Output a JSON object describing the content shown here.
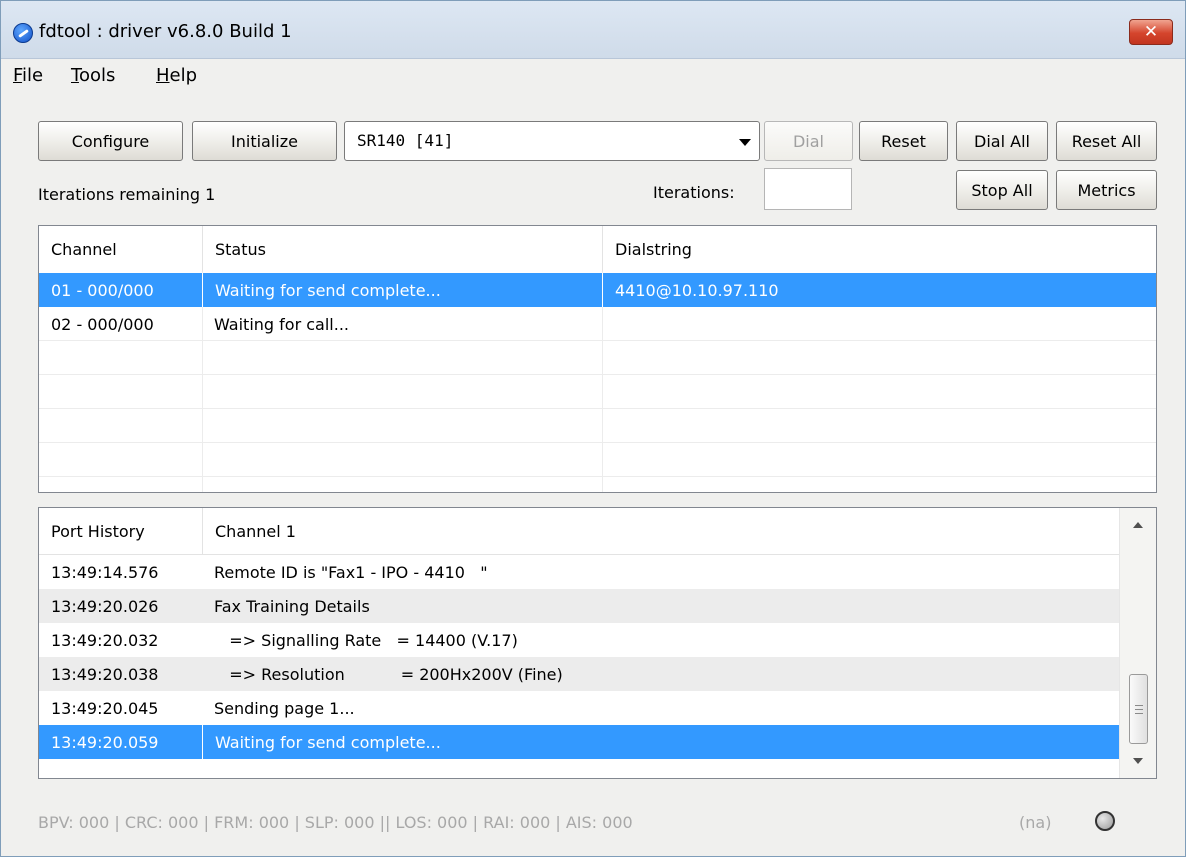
{
  "window": {
    "title": "fdtool : driver v6.8.0 Build 1",
    "close_label": "✕"
  },
  "menu": {
    "items": [
      {
        "mnemonic": "F",
        "rest": "ile"
      },
      {
        "mnemonic": "T",
        "rest": "ools"
      },
      {
        "mnemonic": "H",
        "rest": "elp"
      }
    ]
  },
  "toolbar": {
    "configure_label": "Configure",
    "initialize_label": "Initialize",
    "device_selected": "SR140 [41]",
    "dial_label": "Dial",
    "reset_label": "Reset",
    "dial_all_label": "Dial All",
    "reset_all_label": "Reset All",
    "stop_all_label": "Stop All",
    "metrics_label": "Metrics"
  },
  "iterations": {
    "remaining_text": "Iterations remaining 1",
    "label": "Iterations:",
    "value": ""
  },
  "channels": {
    "headers": [
      "Channel",
      "Status",
      "Dialstring"
    ],
    "rows": [
      {
        "channel": "01 - 000/000",
        "status": "Waiting for send complete...",
        "dialstring": "4410@10.10.97.110",
        "selected": true
      },
      {
        "channel": "02 - 000/000",
        "status": "Waiting for call...",
        "dialstring": "",
        "selected": false
      }
    ]
  },
  "history": {
    "headers": [
      "Port History",
      "Channel 1"
    ],
    "rows": [
      {
        "time": "13:49:14.576",
        "text": "Remote ID is \"Fax1 - IPO - 4410   \""
      },
      {
        "time": "13:49:20.026",
        "text": "Fax Training Details"
      },
      {
        "time": "13:49:20.032",
        "text": "   => Signalling Rate   = 14400 (V.17)"
      },
      {
        "time": "13:49:20.038",
        "text": "   => Resolution           = 200Hx200V (Fine)"
      },
      {
        "time": "13:49:20.045",
        "text": "Sending page 1..."
      },
      {
        "time": "13:49:20.059",
        "text": "Waiting for send complete..."
      }
    ],
    "selected_index": 5
  },
  "status_bar": {
    "counters": "BPV: 000 | CRC: 000 | FRM: 000 | SLP: 000 || LOS: 000 | RAI: 000 | AIS: 000",
    "na_label": "(na)",
    "led_color": "#9a9a9a"
  },
  "colors": {
    "selection": "#3399ff",
    "close_button": "#d5452d"
  }
}
